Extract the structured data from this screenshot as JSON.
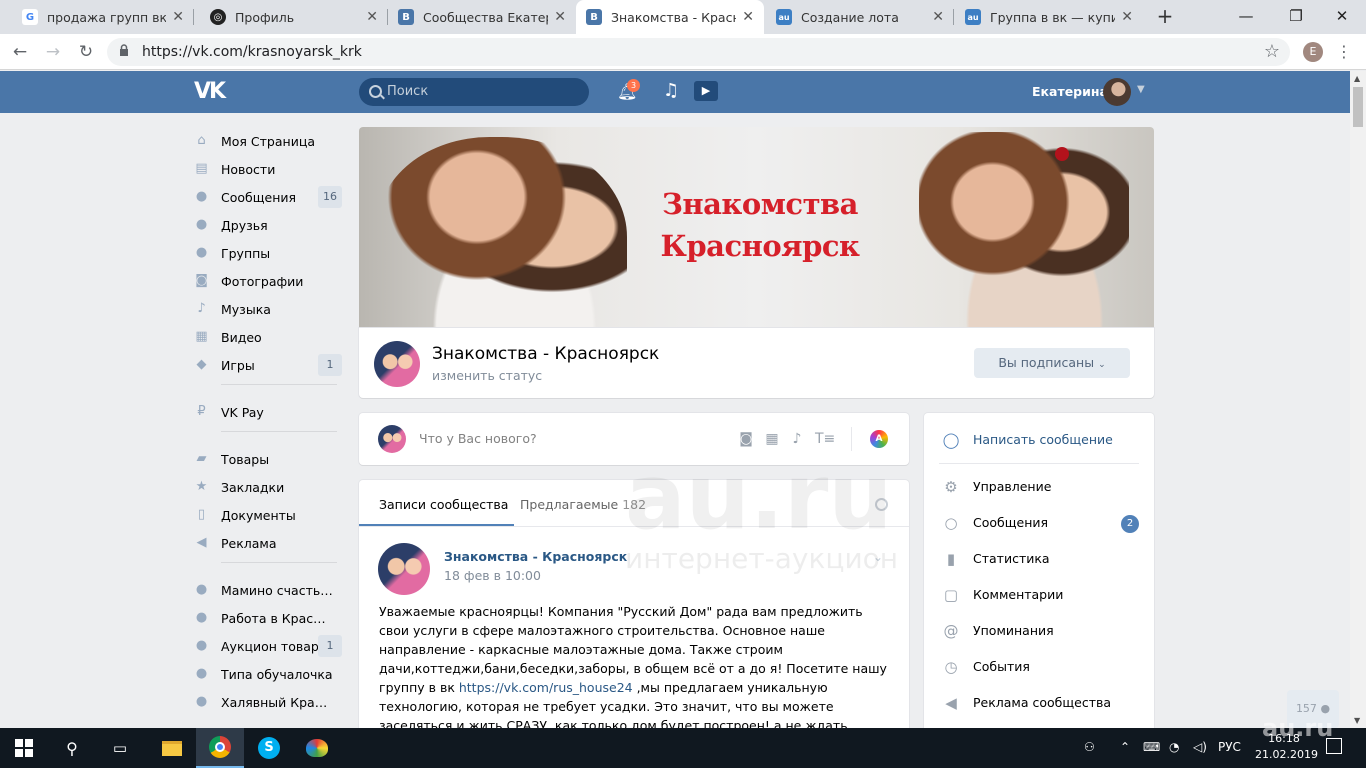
{
  "browser": {
    "tabs": [
      {
        "title": "продажа групп вк - По",
        "icon": "google-icon",
        "color": "#4285f4",
        "glyph": "G"
      },
      {
        "title": "Профиль",
        "icon": "github-icon",
        "color": "#222222",
        "glyph": "◎"
      },
      {
        "title": "Сообщества Екатерин",
        "icon": "vk-icon",
        "color": "#4a76a8",
        "glyph": "В"
      },
      {
        "title": "Знакомства - Красноя",
        "icon": "vk-icon",
        "color": "#4a76a8",
        "glyph": "В"
      },
      {
        "title": "Создание лота",
        "icon": "auction-icon",
        "color": "#3d7fc4",
        "glyph": "au"
      },
      {
        "title": "Группа в вк — купить",
        "icon": "auction-icon",
        "color": "#3d7fc4",
        "glyph": "au"
      }
    ],
    "active_tab": 3,
    "url": "https://vk.com/krasnoyarsk_krk",
    "profile_initial": "E"
  },
  "vk_header": {
    "logo": "VK",
    "search_placeholder": "Поиск",
    "notifications_count": "3",
    "user_name": "Екатерина"
  },
  "left_menu": [
    {
      "label": "Моя Страница",
      "icon": "home-icon",
      "glyph": "⌂"
    },
    {
      "label": "Новости",
      "icon": "news-icon",
      "glyph": "▤"
    },
    {
      "label": "Сообщения",
      "icon": "messages-icon",
      "glyph": "●",
      "count": "16"
    },
    {
      "label": "Друзья",
      "icon": "friends-icon",
      "glyph": "●"
    },
    {
      "label": "Группы",
      "icon": "groups-icon",
      "glyph": "●"
    },
    {
      "label": "Фотографии",
      "icon": "camera-icon",
      "glyph": "◙"
    },
    {
      "label": "Музыка",
      "icon": "music-icon",
      "glyph": "♪"
    },
    {
      "label": "Видео",
      "icon": "video-icon",
      "glyph": "▦"
    },
    {
      "label": "Игры",
      "icon": "games-icon",
      "glyph": "◆",
      "count": "1"
    },
    {
      "label": "VK Pay",
      "icon": "vkpay-icon",
      "glyph": "₽"
    },
    {
      "label": "Товары",
      "icon": "market-icon",
      "glyph": "▰"
    },
    {
      "label": "Закладки",
      "icon": "star-icon",
      "glyph": "★"
    },
    {
      "label": "Документы",
      "icon": "documents-icon",
      "glyph": "▯"
    },
    {
      "label": "Реклама",
      "icon": "ads-icon",
      "glyph": "◀"
    },
    {
      "label": "Мамино счастье-...",
      "icon": "group-icon",
      "glyph": "●"
    },
    {
      "label": "Работа в Красно...",
      "icon": "group-icon",
      "glyph": "●"
    },
    {
      "label": "Аукцион товар...",
      "icon": "group-icon",
      "glyph": "●",
      "count": "1"
    },
    {
      "label": "Типа обучалочка",
      "icon": "group-icon",
      "glyph": "●"
    },
    {
      "label": "Халявный Красно...",
      "icon": "group-icon",
      "glyph": "●"
    }
  ],
  "group": {
    "cover_title_line1": "Знакомства",
    "cover_title_line2": "Красноярск",
    "name": "Знакомства - Красноярск",
    "status": "изменить статус",
    "subscribe_label": "Вы подписаны",
    "accent": "#4a76a8",
    "cover_text_color": "#d6202a"
  },
  "composer": {
    "placeholder": "Что у Вас нового?",
    "tools": [
      "camera-icon",
      "video-icon",
      "music-icon",
      "text-icon"
    ],
    "art_label": "A"
  },
  "wall": {
    "tab_posts": "Записи сообщества",
    "tab_suggested": "Предлагаемые",
    "suggested_count": "182",
    "post": {
      "author": "Знакомства - Красноярск",
      "date": "18 фев в 10:00",
      "text_before": "Уважаемые красноярцы! Компания \"Русский Дом\" рада вам предложить свои услуги в сфере малоэтажного строительства. Основное наше направление - каркасные малоэтажные дома. Также строим дачи,коттеджи,бани,беседки,заборы, в общем всё от а до я! Посетите нашу группу в вк ",
      "link": "https://vk.com/rus_house24",
      "text_after": " ,мы предлагаем уникальную технологию, которая не требует усадки. Это значит, что вы можете заселяться и жить СРАЗУ, как только дом будет построен! а не ждать полтора года, пока дом \"сядет\"! по"
    }
  },
  "actions": {
    "write_message": "Написать сообщение",
    "items": [
      {
        "label": "Управление",
        "icon": "gear-icon",
        "glyph": "⚙"
      },
      {
        "label": "Сообщения",
        "icon": "chat-icon",
        "glyph": "○",
        "badge": "2"
      },
      {
        "label": "Статистика",
        "icon": "stats-icon",
        "glyph": "▮"
      },
      {
        "label": "Комментарии",
        "icon": "comments-icon",
        "glyph": "▢"
      },
      {
        "label": "Упоминания",
        "icon": "mention-icon",
        "glyph": "@"
      },
      {
        "label": "События",
        "icon": "events-icon",
        "glyph": "◷"
      },
      {
        "label": "Реклама сообщества",
        "icon": "megaphone-icon",
        "glyph": "◀"
      }
    ]
  },
  "friends_online": "157",
  "watermark": {
    "logo": "au.ru",
    "text": "интернет-аукцион"
  },
  "taskbar": {
    "lang": "РУС",
    "time": "16:18",
    "date": "21.02.2019"
  }
}
